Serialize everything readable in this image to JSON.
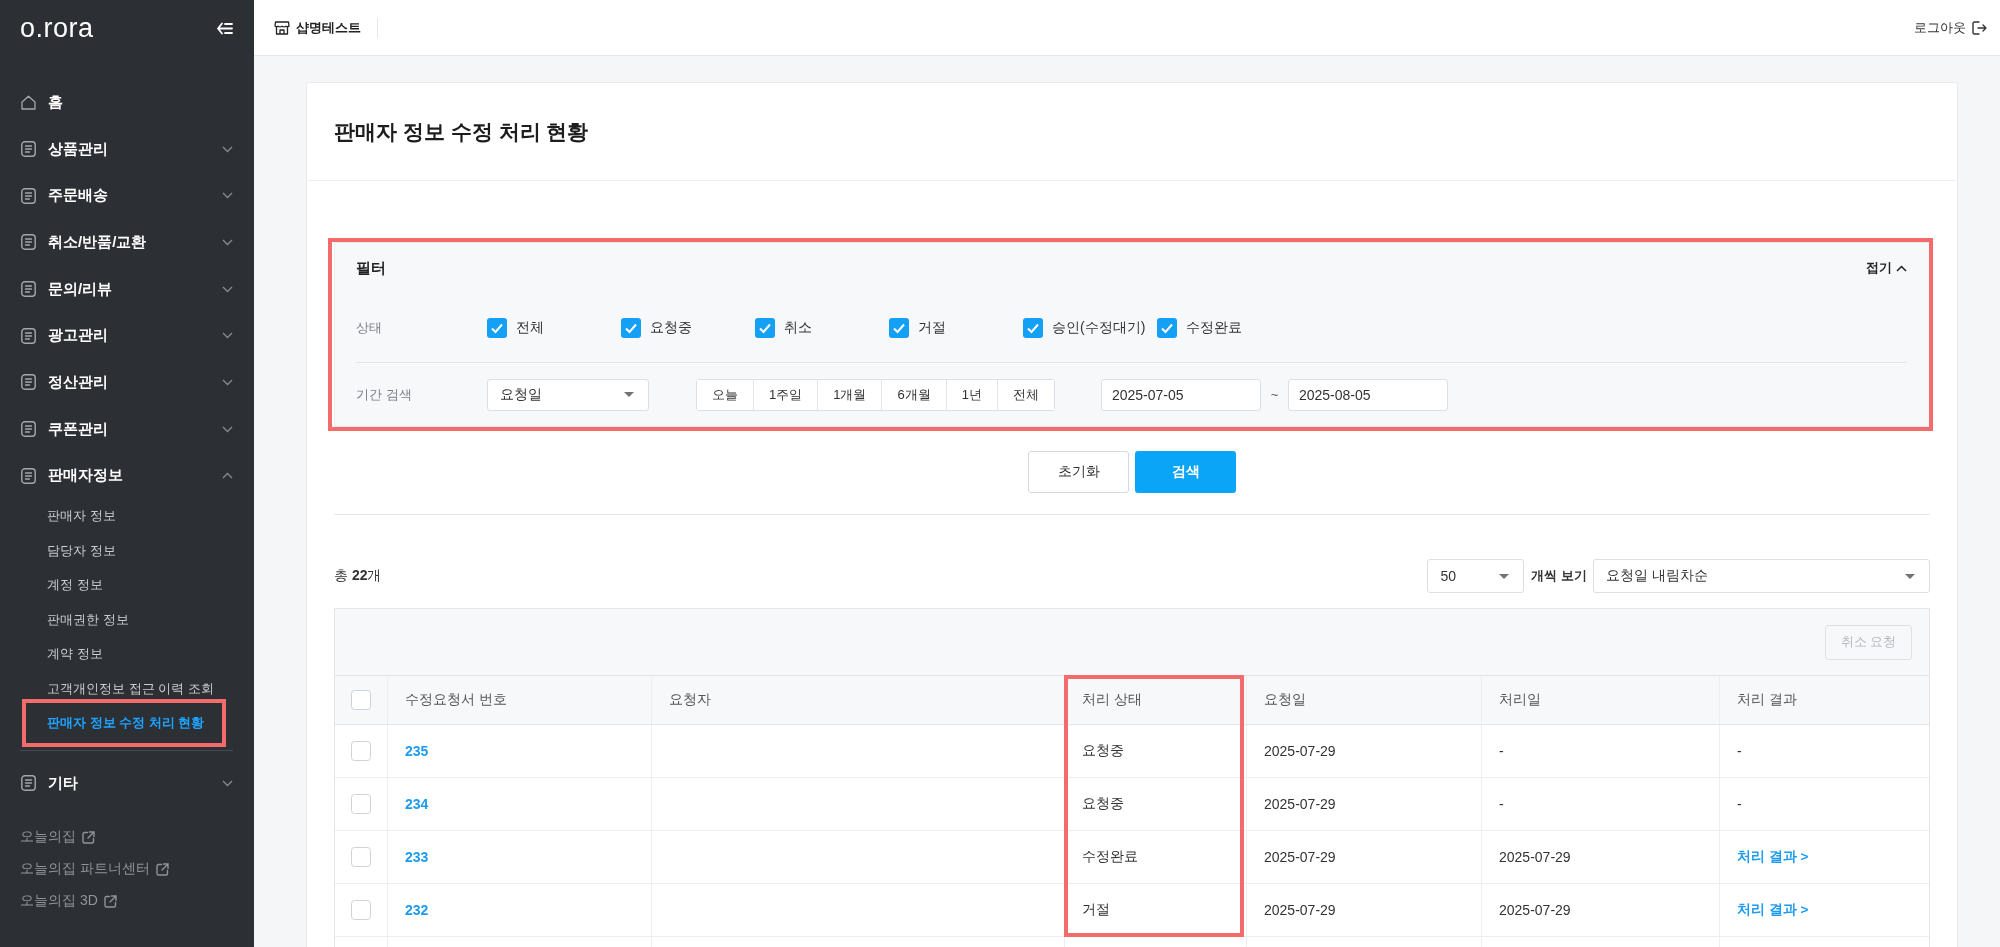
{
  "sidebar": {
    "logo": "o.rora",
    "menu": [
      {
        "label": "홈",
        "kind": "home"
      },
      {
        "label": "상품관리",
        "kind": "group",
        "expanded": false
      },
      {
        "label": "주문배송",
        "kind": "group",
        "expanded": false
      },
      {
        "label": "취소/반품/교환",
        "kind": "group",
        "expanded": false
      },
      {
        "label": "문의/리뷰",
        "kind": "group",
        "expanded": false
      },
      {
        "label": "광고관리",
        "kind": "group",
        "expanded": false
      },
      {
        "label": "정산관리",
        "kind": "group",
        "expanded": false
      },
      {
        "label": "쿠폰관리",
        "kind": "group",
        "expanded": false
      },
      {
        "label": "판매자정보",
        "kind": "group",
        "expanded": true,
        "children": [
          {
            "label": "판매자 정보",
            "selected": false,
            "highlighted": false
          },
          {
            "label": "담당자 정보",
            "selected": false,
            "highlighted": false
          },
          {
            "label": "계정 정보",
            "selected": false,
            "highlighted": false
          },
          {
            "label": "판매권한 정보",
            "selected": false,
            "highlighted": false
          },
          {
            "label": "계약 정보",
            "selected": false,
            "highlighted": false
          },
          {
            "label": "고객개인정보 접근 이력 조회",
            "selected": false,
            "highlighted": false
          },
          {
            "label": "판매자 정보 수정 처리 현황",
            "selected": true,
            "highlighted": true
          }
        ]
      },
      {
        "label": "기타",
        "kind": "group",
        "expanded": false
      }
    ],
    "links": [
      {
        "label": "오늘의집"
      },
      {
        "label": "오늘의집 파트너센터"
      },
      {
        "label": "오늘의집 3D"
      }
    ]
  },
  "header": {
    "shop_name": "샵명테스트",
    "logout": "로그아웃"
  },
  "page": {
    "title": "판매자 정보 수정 처리 현황"
  },
  "filter": {
    "title": "필터",
    "collapse": "접기",
    "highlighted": true,
    "status_label": "상태",
    "statuses": [
      {
        "label": "전체",
        "checked": true
      },
      {
        "label": "요청중",
        "checked": true
      },
      {
        "label": "취소",
        "checked": true
      },
      {
        "label": "거절",
        "checked": true
      },
      {
        "label": "승인(수정대기)",
        "checked": true
      },
      {
        "label": "수정완료",
        "checked": true
      }
    ],
    "period_label": "기간 검색",
    "date_type": "요청일",
    "ranges": [
      {
        "label": "오늘",
        "selected": false
      },
      {
        "label": "1주일",
        "selected": false
      },
      {
        "label": "1개월",
        "selected": false
      },
      {
        "label": "6개월",
        "selected": false
      },
      {
        "label": "1년",
        "selected": false
      },
      {
        "label": "전체",
        "selected": false
      }
    ],
    "date_from": "2025-07-05",
    "date_separator": "~",
    "date_to": "2025-08-05"
  },
  "actions": {
    "reset": "초기화",
    "search": "검색"
  },
  "results": {
    "total": "총 **22**개",
    "page_size": "50",
    "page_size_label": "개씩 보기",
    "sort": "요청일 내림차순"
  },
  "table": {
    "cancel_button": {
      "label": "취소 요청",
      "disabled": true
    },
    "select_all_checked": false,
    "columns": [
      {
        "label": "수정요청서 번호",
        "highlighted": false
      },
      {
        "label": "요청자",
        "highlighted": false
      },
      {
        "label": "처리 상태",
        "highlighted": true
      },
      {
        "label": "요청일",
        "highlighted": false
      },
      {
        "label": "처리일",
        "highlighted": false
      },
      {
        "label": "처리 결과",
        "highlighted": false
      }
    ],
    "rows": [
      {
        "checked": false,
        "number": "235",
        "status": "요청중",
        "requested": "2025-07-29",
        "processed": "-",
        "result": {
          "kind": "text",
          "label": "-"
        }
      },
      {
        "checked": false,
        "number": "234",
        "status": "요청중",
        "requested": "2025-07-29",
        "processed": "-",
        "result": {
          "kind": "text",
          "label": "-"
        }
      },
      {
        "checked": false,
        "number": "233",
        "status": "수정완료",
        "requested": "2025-07-29",
        "processed": "2025-07-29",
        "result": {
          "kind": "link",
          "label": "처리 결과 >"
        }
      },
      {
        "checked": false,
        "number": "232",
        "status": "거절",
        "requested": "2025-07-29",
        "processed": "2025-07-29",
        "result": {
          "kind": "link",
          "label": "처리 결과 >"
        }
      }
    ]
  }
}
